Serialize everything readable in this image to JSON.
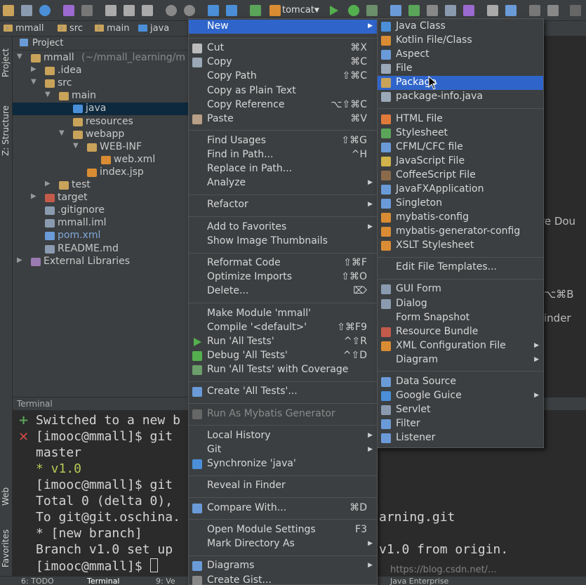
{
  "toolbar": {
    "run_config": "tomcat"
  },
  "breadcrumb": [
    "mmall",
    "src",
    "main",
    "java"
  ],
  "side_tabs": [
    "Project",
    "Z: Structure",
    "Web",
    "Favorites"
  ],
  "project_panel": {
    "title": "Project",
    "tree": [
      {
        "label": "mmall",
        "suffix": "(~/mmall_learning/m",
        "level": 0,
        "arrow": "▼",
        "icon": "module-folder-icon"
      },
      {
        "label": ".idea",
        "level": 1,
        "arrow": "▶",
        "icon": "folder-icon"
      },
      {
        "label": "src",
        "level": 1,
        "arrow": "▼",
        "icon": "folder-icon"
      },
      {
        "label": "main",
        "level": 2,
        "arrow": "▼",
        "icon": "folder-icon"
      },
      {
        "label": "java",
        "level": 3,
        "arrow": "",
        "icon": "source-folder-icon",
        "selected": true
      },
      {
        "label": "resources",
        "level": 3,
        "arrow": "",
        "icon": "folder-icon"
      },
      {
        "label": "webapp",
        "level": 3,
        "arrow": "▼",
        "icon": "web-folder-icon"
      },
      {
        "label": "WEB-INF",
        "level": 4,
        "arrow": "▼",
        "icon": "folder-icon"
      },
      {
        "label": "web.xml",
        "level": 5,
        "arrow": "",
        "icon": "xml-file-icon"
      },
      {
        "label": "index.jsp",
        "level": 4,
        "arrow": "",
        "icon": "jsp-file-icon"
      },
      {
        "label": "test",
        "level": 2,
        "arrow": "▶",
        "icon": "folder-icon"
      },
      {
        "label": "target",
        "level": 1,
        "arrow": "▶",
        "icon": "excluded-folder-icon"
      },
      {
        "label": ".gitignore",
        "level": 1,
        "arrow": "",
        "icon": "text-file-icon"
      },
      {
        "label": "mmall.iml",
        "level": 1,
        "arrow": "",
        "icon": "iml-file-icon"
      },
      {
        "label": "pom.xml",
        "level": 1,
        "arrow": "",
        "icon": "maven-file-icon"
      },
      {
        "label": "README.md",
        "level": 1,
        "arrow": "",
        "icon": "markdown-file-icon"
      },
      {
        "label": "External Libraries",
        "level": 0,
        "arrow": "▶",
        "icon": "library-icon"
      }
    ]
  },
  "editor_fragments": {
    "line1": "re Dou",
    "line2": "⌥⌘B",
    "line3": "inder"
  },
  "context_menu": {
    "items": [
      {
        "label": "New",
        "submenu": true,
        "highlight": true
      },
      {
        "sep": true
      },
      {
        "label": "Cut",
        "shortcut": "⌘X",
        "icon": "scissors-icon"
      },
      {
        "label": "Copy",
        "shortcut": "⌘C",
        "icon": "copy-icon"
      },
      {
        "label": "Copy Path",
        "shortcut": "⇧⌘C"
      },
      {
        "label": "Copy as Plain Text"
      },
      {
        "label": "Copy Reference",
        "shortcut": "⌥⇧⌘C"
      },
      {
        "label": "Paste",
        "shortcut": "⌘V",
        "icon": "paste-icon"
      },
      {
        "sep": true
      },
      {
        "label": "Find Usages",
        "shortcut": "⇧⌘G"
      },
      {
        "label": "Find in Path...",
        "shortcut": "^H"
      },
      {
        "label": "Replace in Path..."
      },
      {
        "label": "Analyze",
        "submenu": true
      },
      {
        "sep": true
      },
      {
        "label": "Refactor",
        "submenu": true
      },
      {
        "sep": true
      },
      {
        "label": "Add to Favorites",
        "submenu": true
      },
      {
        "label": "Show Image Thumbnails"
      },
      {
        "sep": true
      },
      {
        "label": "Reformat Code",
        "shortcut": "⇧⌘F"
      },
      {
        "label": "Optimize Imports",
        "shortcut": "⇧⌘O"
      },
      {
        "label": "Delete...",
        "shortcut": "⌦"
      },
      {
        "sep": true
      },
      {
        "label": "Make Module 'mmall'"
      },
      {
        "label": "Compile '<default>'",
        "shortcut": "⇧⌘F9"
      },
      {
        "label": "Run 'All Tests'",
        "shortcut": "^⇧R",
        "icon": "run-icon"
      },
      {
        "label": "Debug 'All Tests'",
        "shortcut": "^⇧D",
        "icon": "debug-icon"
      },
      {
        "label": "Run 'All Tests' with Coverage",
        "icon": "coverage-icon"
      },
      {
        "sep": true
      },
      {
        "label": "Create 'All Tests'...",
        "icon": "create-test-icon"
      },
      {
        "sep": true
      },
      {
        "label": "Run As Mybatis Generator",
        "disabled": true,
        "icon": "mybatis-icon"
      },
      {
        "sep": true
      },
      {
        "label": "Local History",
        "submenu": true
      },
      {
        "label": "Git",
        "submenu": true
      },
      {
        "label": "Synchronize 'java'",
        "icon": "sync-icon"
      },
      {
        "sep": true
      },
      {
        "label": "Reveal in Finder"
      },
      {
        "sep": true
      },
      {
        "label": "Compare With...",
        "shortcut": "⌘D",
        "icon": "compare-icon"
      },
      {
        "sep": true
      },
      {
        "label": "Open Module Settings",
        "shortcut": "F3"
      },
      {
        "label": "Mark Directory As",
        "submenu": true
      },
      {
        "sep": true
      },
      {
        "label": "Diagrams",
        "submenu": true,
        "icon": "diagram-icon"
      },
      {
        "label": "Create Gist...",
        "icon": "gist-icon"
      }
    ]
  },
  "submenu": {
    "items": [
      {
        "label": "Java Class",
        "icon": "java-class-icon"
      },
      {
        "label": "Kotlin File/Class",
        "icon": "kotlin-icon"
      },
      {
        "label": "Aspect",
        "icon": "aspect-icon"
      },
      {
        "label": "File",
        "icon": "file-icon"
      },
      {
        "label": "Package",
        "icon": "package-icon",
        "highlight": true
      },
      {
        "label": "package-info.java",
        "icon": "java-file-icon"
      },
      {
        "sep": true
      },
      {
        "label": "HTML File",
        "icon": "html-icon"
      },
      {
        "label": "Stylesheet",
        "icon": "css-icon"
      },
      {
        "label": "CFML/CFC file",
        "icon": "cfml-icon"
      },
      {
        "label": "JavaScript File",
        "icon": "js-icon"
      },
      {
        "label": "CoffeeScript File",
        "icon": "coffee-icon"
      },
      {
        "label": "JavaFXApplication",
        "icon": "javafx-icon"
      },
      {
        "label": "Singleton",
        "icon": "singleton-icon"
      },
      {
        "label": "mybatis-config",
        "icon": "mybatis-file-icon"
      },
      {
        "label": "mybatis-generator-config",
        "icon": "mybatis-file-icon"
      },
      {
        "label": "XSLT Stylesheet",
        "icon": "xslt-icon"
      },
      {
        "sep": true
      },
      {
        "label": "Edit File Templates..."
      },
      {
        "sep": true
      },
      {
        "label": "GUI Form",
        "icon": "gui-form-icon"
      },
      {
        "label": "Dialog",
        "icon": "dialog-icon"
      },
      {
        "label": "Form Snapshot"
      },
      {
        "label": "Resource Bundle",
        "icon": "resource-bundle-icon"
      },
      {
        "label": "XML Configuration File",
        "icon": "xml-config-icon",
        "submenu": true
      },
      {
        "label": "Diagram",
        "submenu": true
      },
      {
        "sep": true
      },
      {
        "label": "Data Source",
        "icon": "data-source-icon"
      },
      {
        "label": "Google Guice",
        "icon": "guice-icon",
        "submenu": true
      },
      {
        "label": "Servlet",
        "icon": "servlet-icon"
      },
      {
        "label": "Filter",
        "icon": "filter-icon"
      },
      {
        "label": "Listener",
        "icon": "listener-icon"
      }
    ]
  },
  "terminal": {
    "title": "Terminal",
    "lines": [
      "Switched to a new b",
      "[imooc@mmall]$ git",
      "  master",
      "* v1.0",
      "[imooc@mmall]$ git",
      "Total 0 (delta 0),",
      "To git@git.oschina.",
      " * [new branch]",
      "Branch v1.0 set up",
      "[imooc@mmall]$ "
    ],
    "right_fragments": {
      "repo": "arning.git",
      "origin": "v1.0 from origin."
    }
  },
  "bottom_tabs": [
    "6: TODO",
    "Terminal",
    "9: Ve",
    "Java Enterprise"
  ],
  "watermark": "https://blog.csdn.net/...",
  "colors": {
    "highlight": "#2f65ca",
    "selection": "#0d293e",
    "menu_bg": "#3c3f41"
  }
}
